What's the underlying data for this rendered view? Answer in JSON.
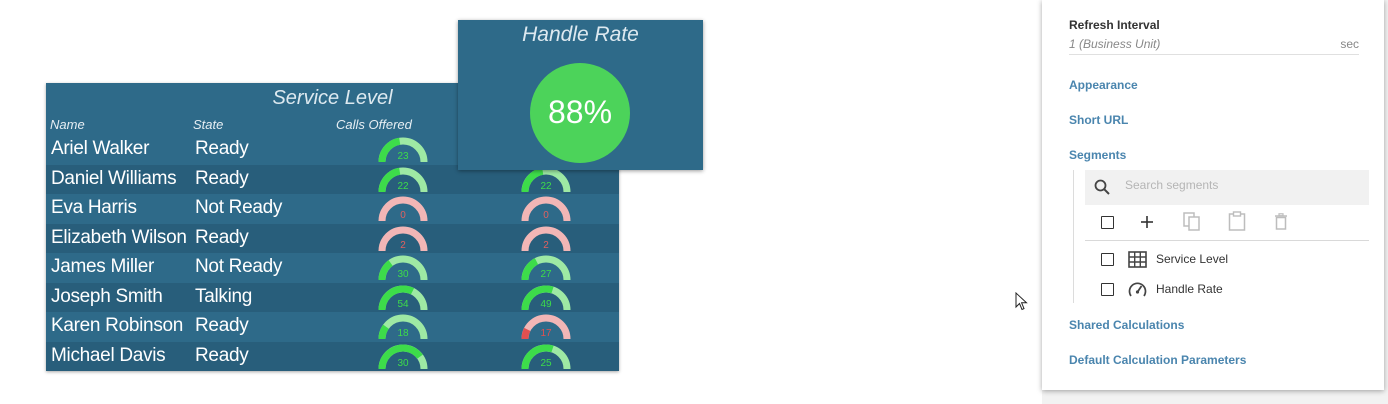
{
  "service_level": {
    "title": "Service Level",
    "columns": {
      "name": "Name",
      "state": "State",
      "calls_offered": "Calls Offered"
    },
    "rows": [
      {
        "name": "Ariel Walker",
        "state": "Ready",
        "g1": {
          "value": "23",
          "fill": 0.45,
          "color": "#3ddc4a",
          "track": "#9ee9a4",
          "text": "#3ddc4a"
        },
        "g2": null
      },
      {
        "name": "Daniel Williams",
        "state": "Ready",
        "g1": {
          "value": "22",
          "fill": 0.45,
          "color": "#3ddc4a",
          "track": "#9ee9a4",
          "text": "#3ddc4a"
        },
        "g2": {
          "value": "22",
          "fill": 0.45,
          "color": "#3ddc4a",
          "track": "#9ee9a4",
          "text": "#3ddc4a"
        }
      },
      {
        "name": "Eva Harris",
        "state": "Not Ready",
        "g1": {
          "value": "0",
          "fill": 0,
          "color": "#e06060",
          "track": "#f2b6b6",
          "text": "#e06060"
        },
        "g2": {
          "value": "0",
          "fill": 0,
          "color": "#e06060",
          "track": "#f2b6b6",
          "text": "#e06060"
        }
      },
      {
        "name": "Elizabeth Wilson",
        "state": "Ready",
        "g1": {
          "value": "2",
          "fill": 0,
          "color": "#e06060",
          "track": "#f2b6b6",
          "text": "#e06060"
        },
        "g2": {
          "value": "2",
          "fill": 0,
          "color": "#e06060",
          "track": "#f2b6b6",
          "text": "#e06060"
        }
      },
      {
        "name": "James Miller",
        "state": "Not Ready",
        "g1": {
          "value": "30",
          "fill": 0.3,
          "color": "#3ddc4a",
          "track": "#9ee9a4",
          "text": "#3ddc4a"
        },
        "g2": {
          "value": "27",
          "fill": 0.35,
          "color": "#3ddc4a",
          "track": "#9ee9a4",
          "text": "#3ddc4a"
        }
      },
      {
        "name": "Joseph Smith",
        "state": "Talking",
        "g1": {
          "value": "54",
          "fill": 0.65,
          "color": "#3ddc4a",
          "track": "#9ee9a4",
          "text": "#3ddc4a"
        },
        "g2": {
          "value": "49",
          "fill": 0.6,
          "color": "#3ddc4a",
          "track": "#9ee9a4",
          "text": "#3ddc4a"
        }
      },
      {
        "name": "Karen Robinson",
        "state": "Ready",
        "g1": {
          "value": "18",
          "fill": 0.2,
          "color": "#3ddc4a",
          "track": "#9ee9a4",
          "text": "#3ddc4a"
        },
        "g2": {
          "value": "17",
          "fill": 0.15,
          "color": "#e05050",
          "track": "#f2b6b6",
          "text": "#e05050"
        }
      },
      {
        "name": "Michael Davis",
        "state": "Ready",
        "g1": {
          "value": "30",
          "fill": 0.8,
          "color": "#3ddc4a",
          "track": "#9ee9a4",
          "text": "#3ddc4a"
        },
        "g2": {
          "value": "25",
          "fill": 0.6,
          "color": "#3ddc4a",
          "track": "#9ee9a4",
          "text": "#3ddc4a"
        }
      }
    ]
  },
  "handle_rate": {
    "title": "Handle Rate",
    "value": "88%",
    "color": "#4cd35a"
  },
  "panel": {
    "refresh_label": "Refresh Interval",
    "refresh_value": "1 (Business Unit)",
    "refresh_unit": "sec",
    "appearance": "Appearance",
    "short_url": "Short URL",
    "segments": "Segments",
    "search_placeholder": "Search segments",
    "segment_items": [
      {
        "label": "Service Level",
        "icon": "table-icon"
      },
      {
        "label": "Handle Rate",
        "icon": "gauge-icon"
      }
    ],
    "shared_calculations": "Shared Calculations",
    "default_params": "Default Calculation Parameters"
  },
  "colors": {
    "widget_bg": "#2e6a89",
    "row_alt": "#285e7b",
    "link": "#4a85ae"
  }
}
